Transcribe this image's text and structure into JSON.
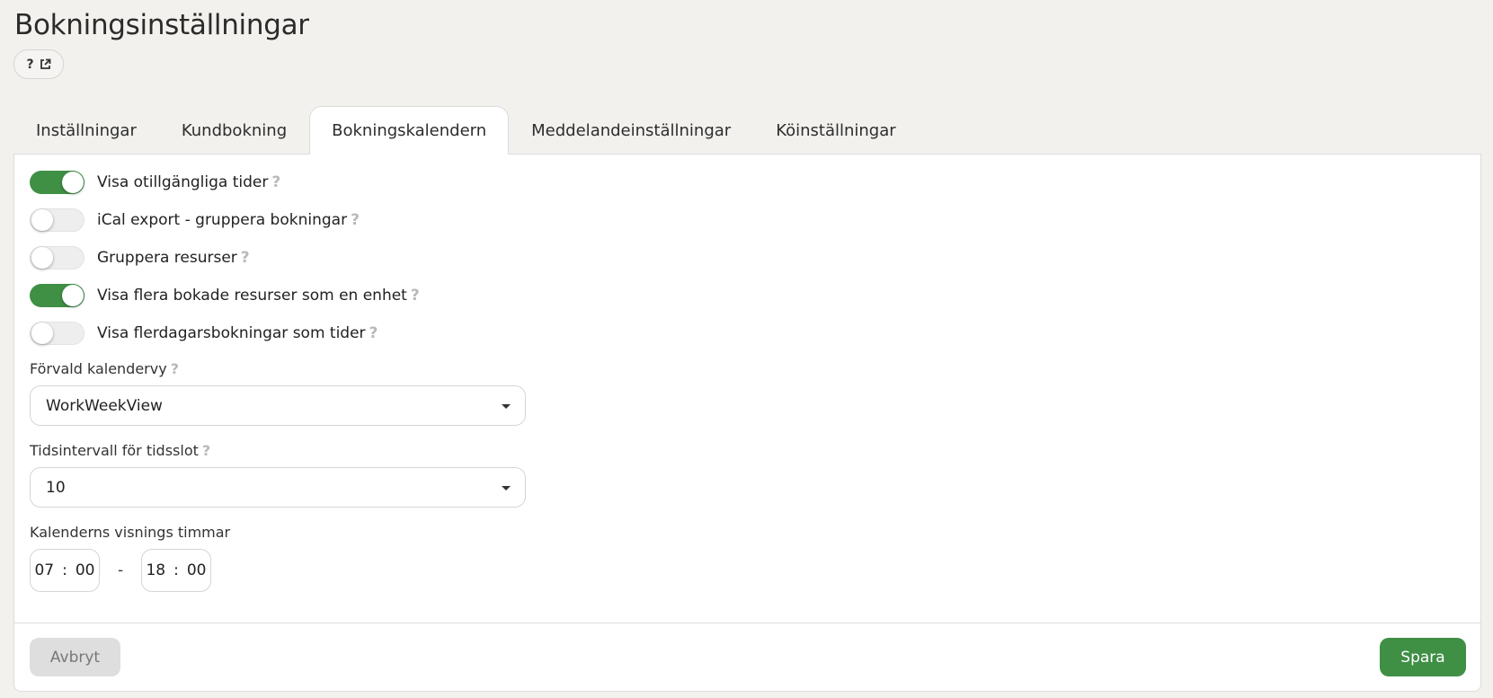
{
  "page": {
    "title": "Bokningsinställningar",
    "help_icon_glyph": "?"
  },
  "tabs": [
    {
      "label": "Inställningar",
      "active": false
    },
    {
      "label": "Kundbokning",
      "active": false
    },
    {
      "label": "Bokningskalendern",
      "active": true
    },
    {
      "label": "Meddelandeinställningar",
      "active": false
    },
    {
      "label": "Köinställningar",
      "active": false
    }
  ],
  "toggles": [
    {
      "label": "Visa otillgängliga tider",
      "on": true
    },
    {
      "label": "iCal export - gruppera bokningar",
      "on": false
    },
    {
      "label": "Gruppera resurser",
      "on": false
    },
    {
      "label": "Visa flera bokade resurser som en enhet",
      "on": true
    },
    {
      "label": "Visa flerdagarsbokningar som tider",
      "on": false
    }
  ],
  "fields": {
    "default_view": {
      "label": "Förvald kalendervy",
      "value": "WorkWeekView"
    },
    "slot_interval": {
      "label": "Tidsintervall för tidsslot",
      "value": "10"
    },
    "display_hours": {
      "label": "Kalenderns visnings timmar",
      "start_hour": "07",
      "start_minute": "00",
      "end_hour": "18",
      "end_minute": "00",
      "colon": ":",
      "separator": "-"
    }
  },
  "footer": {
    "cancel_label": "Avbryt",
    "save_label": "Spara"
  },
  "colors": {
    "accent": "#3f8f45",
    "background": "#f2f1ee"
  },
  "icons": {
    "help": "question-mark-icon",
    "external": "external-link-icon"
  }
}
